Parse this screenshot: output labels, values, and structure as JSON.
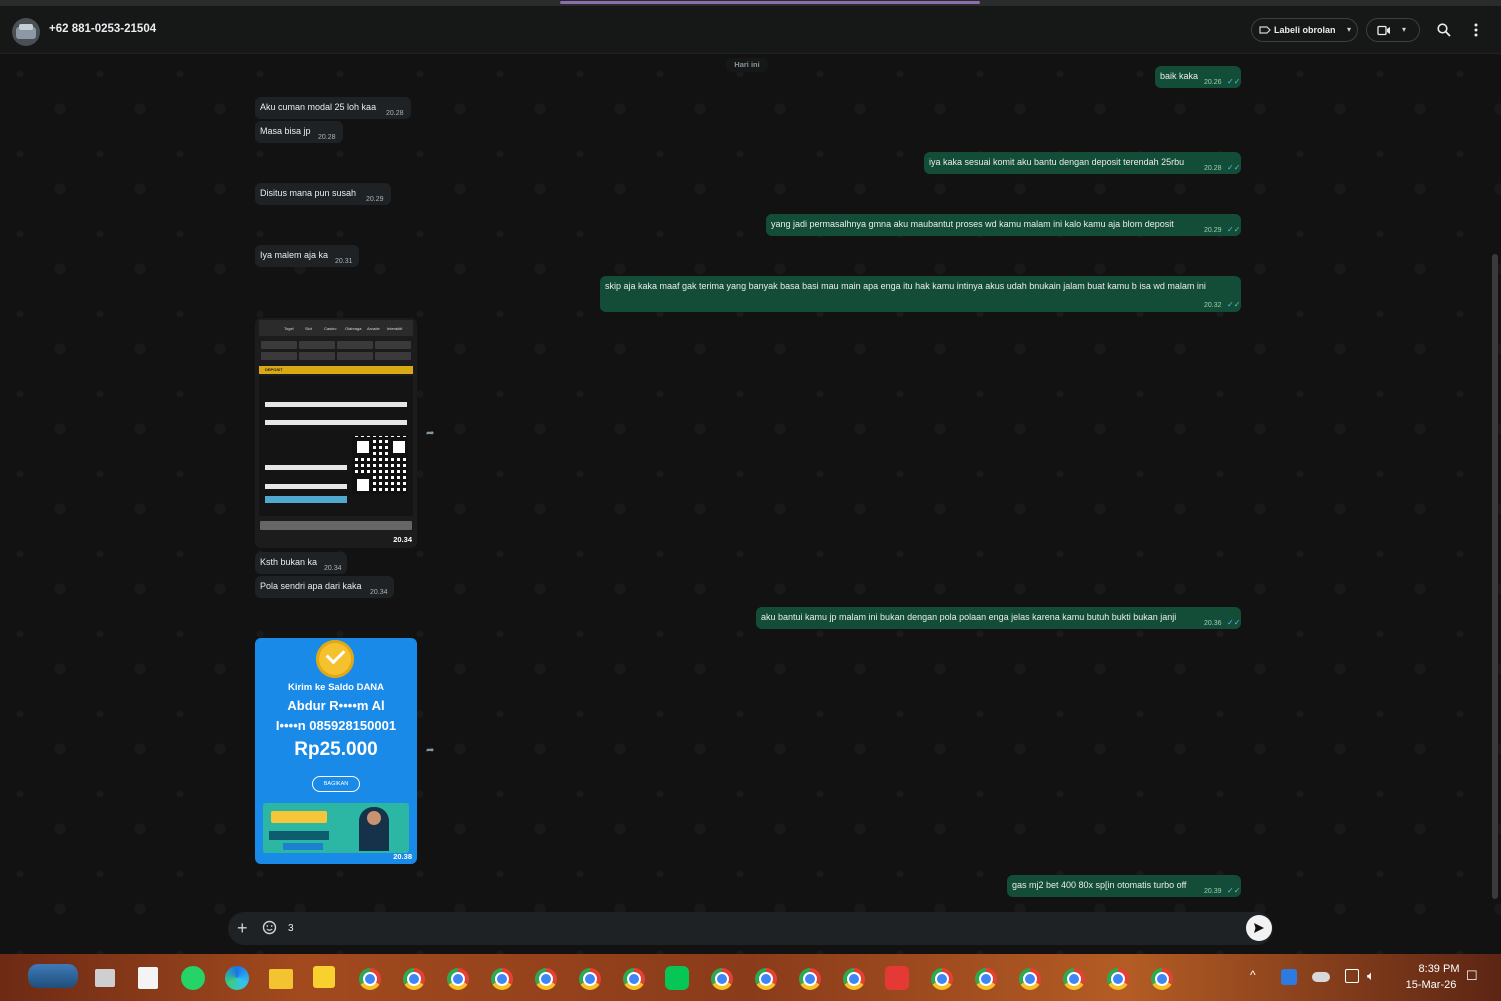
{
  "header": {
    "contact": "+62 881-0253-21504",
    "label_button": "Labeli obrolan"
  },
  "chat": {
    "date_chip": "Hari ini",
    "messages": [
      {
        "dir": "out",
        "text": "baik kaka",
        "time": "20.26"
      },
      {
        "dir": "in",
        "text": "Aku cuman modal 25 loh kaa",
        "time": "20.28"
      },
      {
        "dir": "in",
        "text": "Masa bisa jp",
        "time": "20.28"
      },
      {
        "dir": "out",
        "text": "iya kaka sesuai komit aku bantu dengan deposit terendah 25rbu",
        "time": "20.28"
      },
      {
        "dir": "in",
        "text": "Disitus mana pun susah",
        "time": "20.29"
      },
      {
        "dir": "out",
        "text": "yang jadi permasalhnya gmna aku maubantut proses wd kamu malam ini kalo kamu aja blom deposit",
        "time": "20.29"
      },
      {
        "dir": "in",
        "text": "Iya malem aja ka",
        "time": "20.31"
      },
      {
        "dir": "out",
        "text": "skip aja kaka maaf gak terima yang banyak basa basi mau main apa enga itu hak kamu intinya akus udah bnukain jalam buat kamu b isa wd malam ini",
        "time": "20.32"
      },
      {
        "dir": "in",
        "type": "image",
        "time": "20.34"
      },
      {
        "dir": "in",
        "text": "Ksth bukan ka",
        "time": "20.34"
      },
      {
        "dir": "in",
        "text": "Pola sendri apa dari kaka",
        "time": "20.34"
      },
      {
        "dir": "out",
        "text": "aku bantui kamu jp malam ini bukan dengan pola polaan enga jelas karena kamu butuh bukti bukan janji",
        "time": "20.36"
      },
      {
        "dir": "in",
        "type": "image",
        "time": "20.38"
      },
      {
        "dir": "out",
        "text": "gas mj2 bet 400 80x sp[in otomatis turbo off",
        "time": "20.39"
      }
    ],
    "image1": {
      "section": "DEPOSIT",
      "nav": [
        "Togel",
        "Slot",
        "Casino",
        "Olahraga",
        "Arcade",
        "Interaktif"
      ]
    },
    "image2": {
      "line1": "Kirim ke Saldo DANA",
      "line2": "Abdur R••••m Al",
      "line3": "I••••n 085928150001",
      "amount": "Rp25.000",
      "share": "BAGIKAN"
    }
  },
  "composer": {
    "text": "3"
  },
  "taskbar": {
    "time": "8:39 PM",
    "date": "15-Mar-26"
  },
  "colors": {
    "outgoing_bubble": "#144d37",
    "incoming_bubble": "#1f2224",
    "read_tick": "#53bdeb"
  }
}
